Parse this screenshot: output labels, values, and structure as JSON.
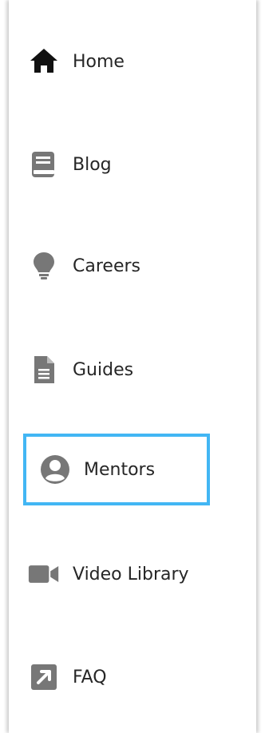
{
  "nav": {
    "items": [
      {
        "label": "Home",
        "icon": "home-icon"
      },
      {
        "label": "Blog",
        "icon": "book-icon"
      },
      {
        "label": "Careers",
        "icon": "lightbulb-icon"
      },
      {
        "label": "Guides",
        "icon": "document-icon"
      },
      {
        "label": "Mentors",
        "icon": "user-circle-icon",
        "highlighted": true
      },
      {
        "label": "Video Library",
        "icon": "video-camera-icon"
      },
      {
        "label": "FAQ",
        "icon": "external-link-icon"
      }
    ]
  },
  "colors": {
    "icon_home": "#111111",
    "icon_gray": "#777777",
    "text": "#262626",
    "highlight_border": "#42b6f4"
  }
}
